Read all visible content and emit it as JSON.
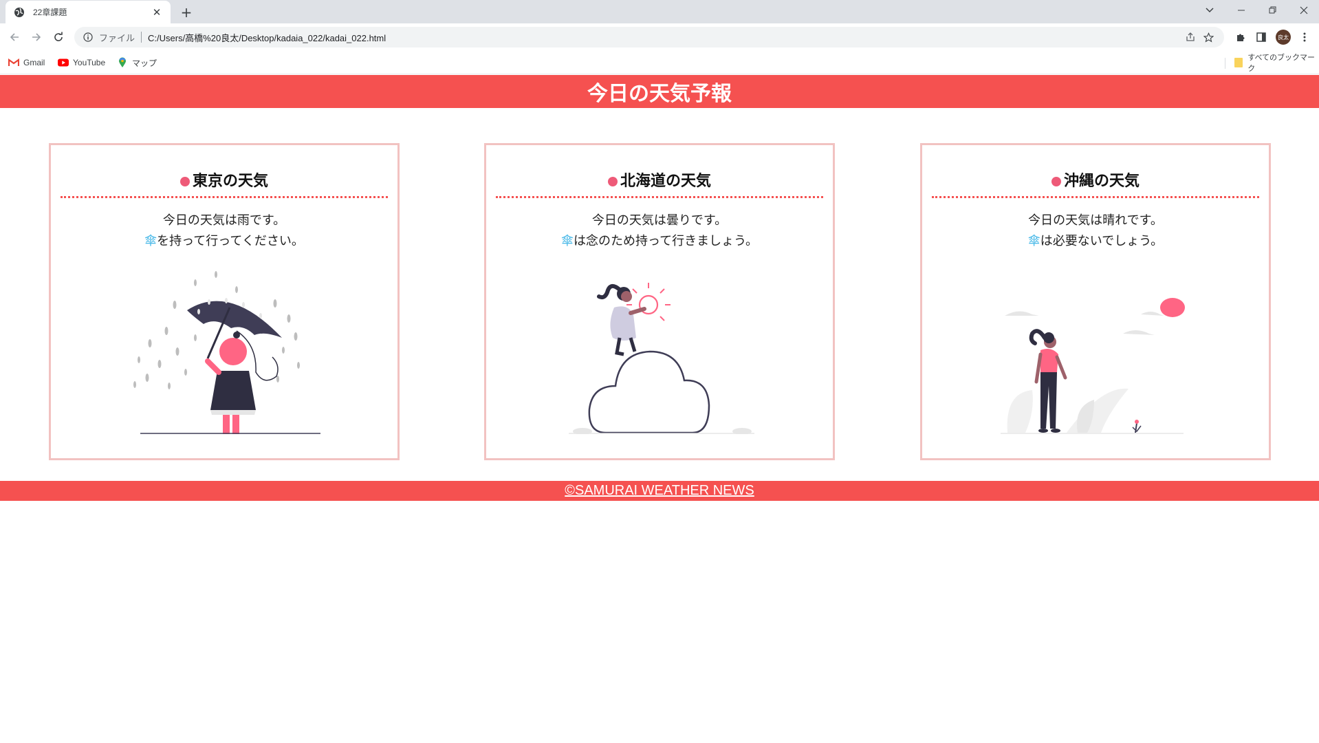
{
  "browser": {
    "tab_title": "22章課題",
    "new_tab": "+",
    "omnibox_scheme": "ファイル",
    "url": "C:/Users/高橋%20良太/Desktop/kadaia_022/kadai_022.html",
    "profile_initials": "良太",
    "bookmarks": [
      {
        "label": "Gmail",
        "icon": "gmail-icon"
      },
      {
        "label": "YouTube",
        "icon": "youtube-icon"
      },
      {
        "label": "マップ",
        "icon": "maps-icon"
      }
    ],
    "all_bookmarks_label": "すべてのブックマーク"
  },
  "page": {
    "header_title": "今日の天気予報",
    "cards": [
      {
        "title": "東京の天気",
        "line1": "今日の天気は雨です。",
        "umbrella": "傘",
        "line2_rest": "を持って行ってください。",
        "illustration": "rain-umbrella-illustration"
      },
      {
        "title": "北海道の天気",
        "line1": "今日の天気は曇りです。",
        "umbrella": "傘",
        "line2_rest": "は念のため持って行きましょう。",
        "illustration": "cloud-illustration"
      },
      {
        "title": "沖縄の天気",
        "line1": "今日の天気は晴れです。",
        "umbrella": "傘",
        "line2_rest": "は必要ないでしょう。",
        "illustration": "sunny-walk-illustration"
      }
    ],
    "footer_text": "©SAMURAI WEATHER NEWS"
  },
  "colors": {
    "accent": "#f55150",
    "card_border": "#f2c2c1",
    "dot": "#ee5a78",
    "umbrella_text": "#49b9e8"
  }
}
